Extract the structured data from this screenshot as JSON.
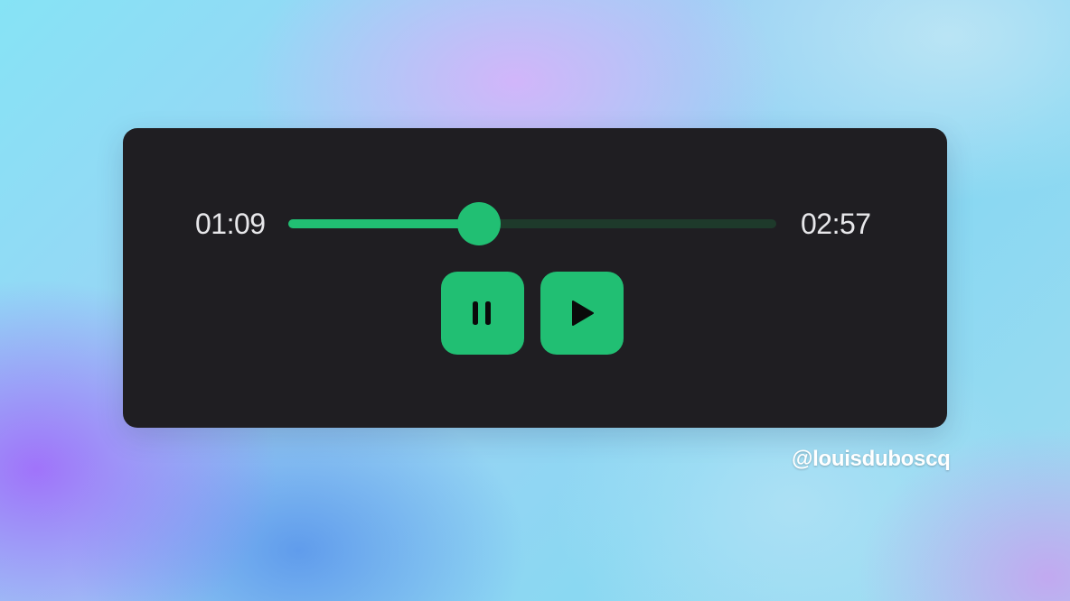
{
  "player": {
    "current_time": "01:09",
    "total_time": "02:57",
    "progress": 0.39,
    "accent_color": "#21bf73",
    "track_color": "#1e3a2b",
    "background_color": "#1f1e22",
    "controls": {
      "pause": {
        "icon": "pause-icon"
      },
      "play": {
        "icon": "play-icon"
      }
    }
  },
  "credit": "@louisduboscq"
}
